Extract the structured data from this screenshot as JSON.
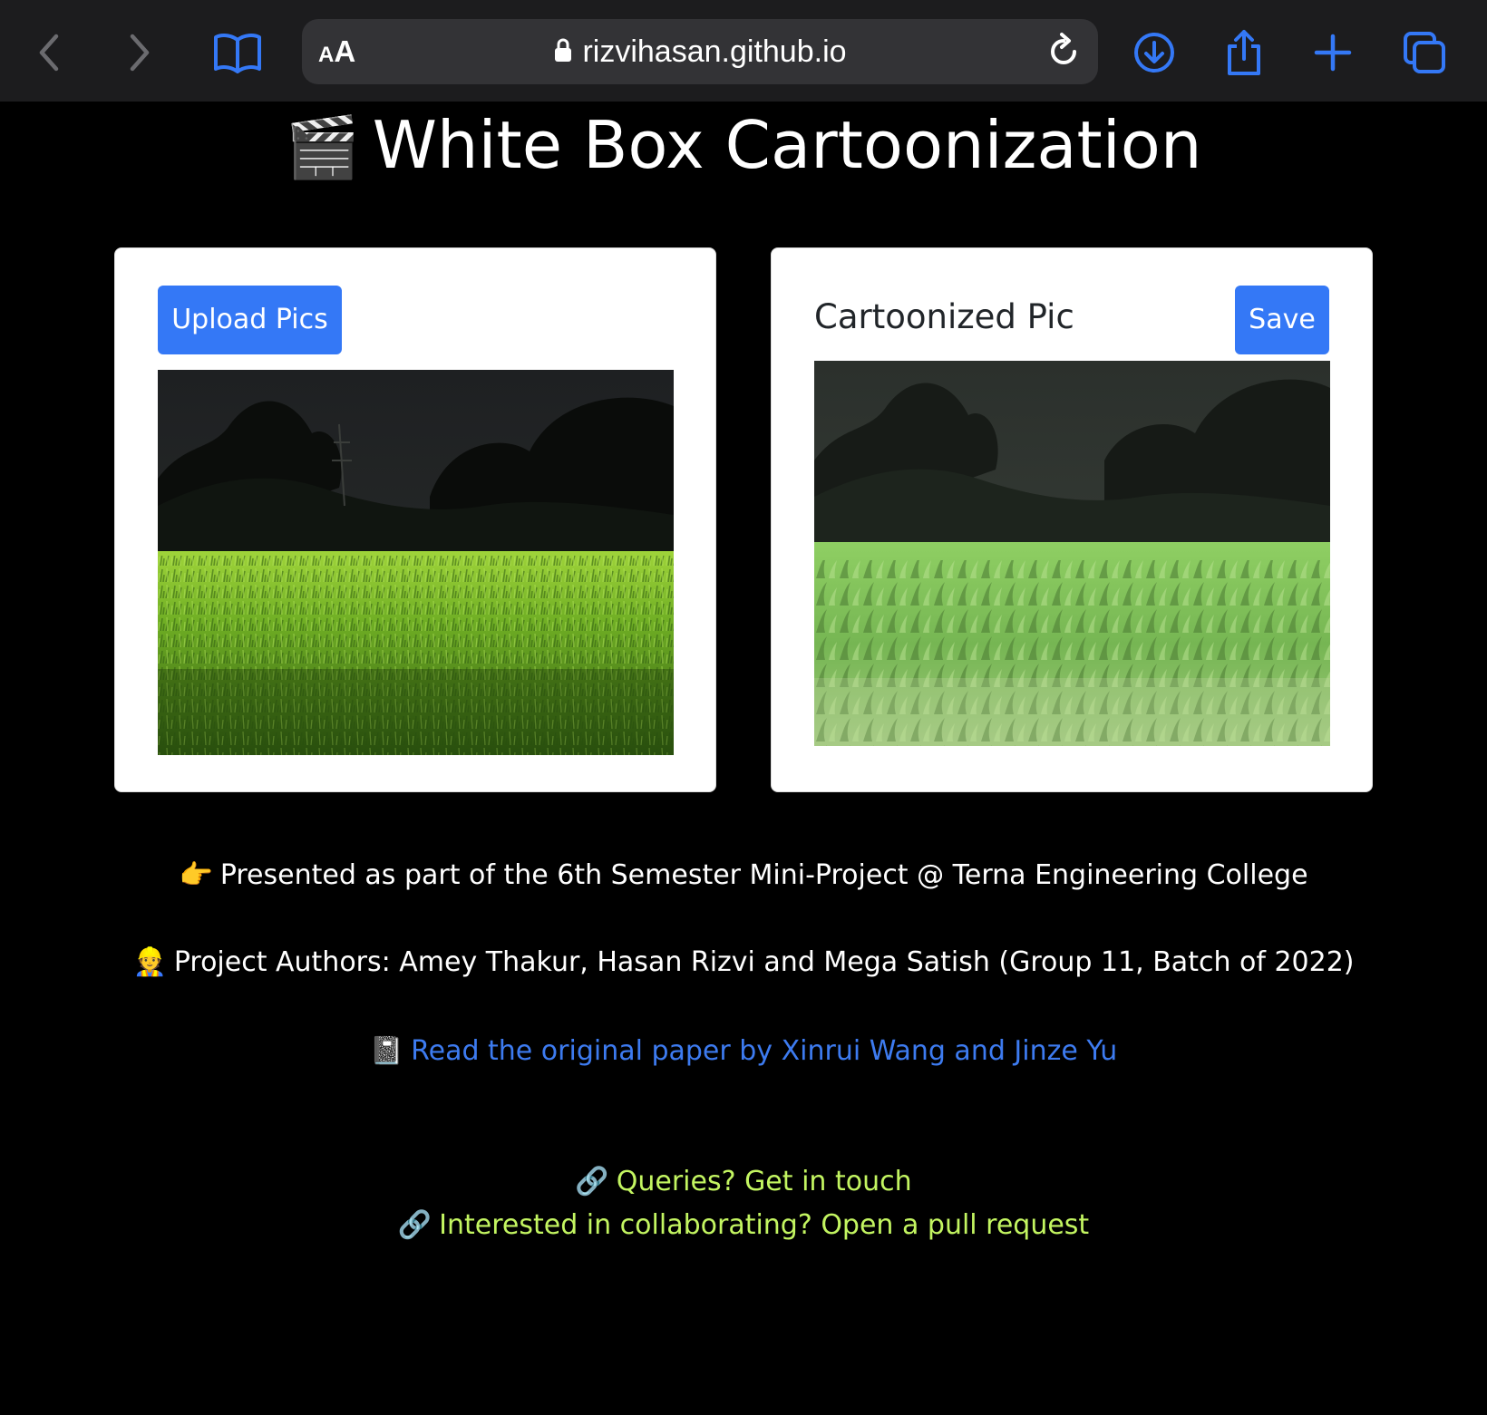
{
  "browser": {
    "text_size_label_small": "A",
    "text_size_label_big": "A",
    "url": "rizvihasan.github.io",
    "icons": [
      "back-icon",
      "forward-icon",
      "bookmarks-icon",
      "lock-icon",
      "reload-icon",
      "download-icon",
      "share-icon",
      "new-tab-icon",
      "tabs-icon"
    ],
    "accent": "#3478f6"
  },
  "page": {
    "title_emoji": "🎬",
    "title": "White Box Cartoonization",
    "upload_label": "Upload Pics",
    "result_heading": "Cartoonized Pic",
    "save_label": "Save",
    "presented_emoji": "👉",
    "presented_text": "Presented as part of the 6th Semester Mini-Project @ Terna Engineering College",
    "authors_emoji": "👷",
    "authors_text": "Project Authors: Amey Thakur, Hasan Rizvi and Mega Satish (Group 11, Batch of 2022)",
    "paper_emoji": "📓",
    "paper_link": "Read the original paper by Xinrui Wang and Jinze Yu",
    "queries_emoji": "🔗",
    "queries_link": "Queries? Get in touch",
    "collab_emoji": "🔗",
    "collab_link": "Interested in collaborating? Open a pull request",
    "colors": {
      "background": "#000000",
      "button": "#3478f6",
      "paper_link": "#3d7bf0",
      "contact_links": "#c3f561"
    }
  }
}
